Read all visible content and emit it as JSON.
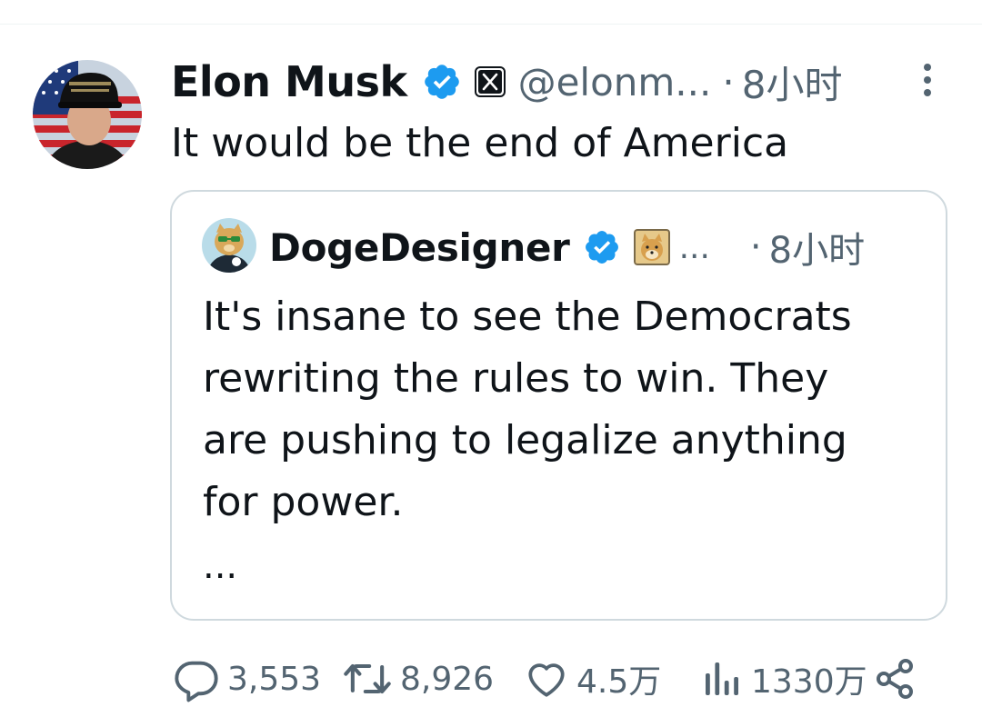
{
  "tweet": {
    "author": {
      "display_name": "Elon Musk",
      "handle": "@elonm...",
      "verified": true,
      "affiliation_badge": "x-logo-icon"
    },
    "separator": "·",
    "time": "8小时",
    "text": "It would be the end of America"
  },
  "quoted_tweet": {
    "author": {
      "display_name": "DogeDesigner",
      "handle": "...",
      "verified": true,
      "affiliation_badge": "doge-icon"
    },
    "separator": "·",
    "time": "8小时",
    "lines": [
      "It's insane to see the Democrats",
      "rewriting the rules to win. They",
      "are pushing to legalize anything",
      "for power."
    ],
    "truncation": "..."
  },
  "actions": {
    "replies": "3,553",
    "reposts": "8,926",
    "likes": "4.5万",
    "views": "1330万"
  },
  "colors": {
    "verified_blue": "#1d9bf0",
    "secondary_text": "#536471",
    "border": "#cfd9de"
  }
}
